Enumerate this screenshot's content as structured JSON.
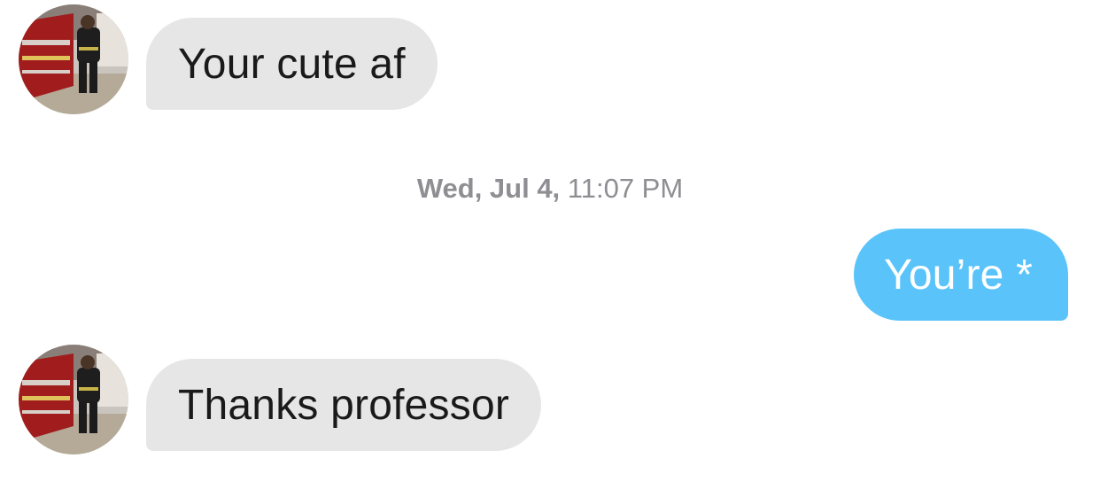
{
  "conversation": {
    "messages": [
      {
        "direction": "incoming",
        "text": "Your cute af",
        "has_avatar": true
      },
      {
        "direction": "outgoing",
        "text": "You’re *"
      },
      {
        "direction": "incoming",
        "text": "Thanks professor",
        "has_avatar": true
      }
    ],
    "timestamp": {
      "day": "Wed, Jul 4,",
      "time": "11:07 PM"
    }
  },
  "colors": {
    "incoming_bubble": "#e6e6e6",
    "outgoing_bubble": "#5ac4fa",
    "incoming_text": "#1a1a1a",
    "outgoing_text": "#ffffff",
    "timestamp_text": "#8e8e93"
  },
  "icons": {
    "avatar": "avatar-photo"
  }
}
